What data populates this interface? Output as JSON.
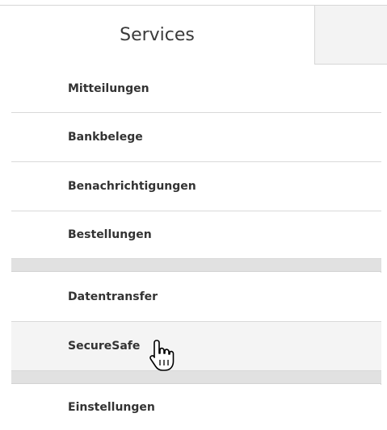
{
  "tabs": {
    "active_label": "Services"
  },
  "menu": {
    "items": [
      {
        "label": "Mitteilungen"
      },
      {
        "label": "Bankbelege"
      },
      {
        "label": "Benachrichtigungen"
      },
      {
        "label": "Bestellungen"
      },
      {
        "label": "Datentransfer"
      },
      {
        "label": "SecureSafe"
      },
      {
        "label": "Einstellungen"
      }
    ]
  },
  "cursor": {
    "icon": "hand-pointer-icon"
  }
}
